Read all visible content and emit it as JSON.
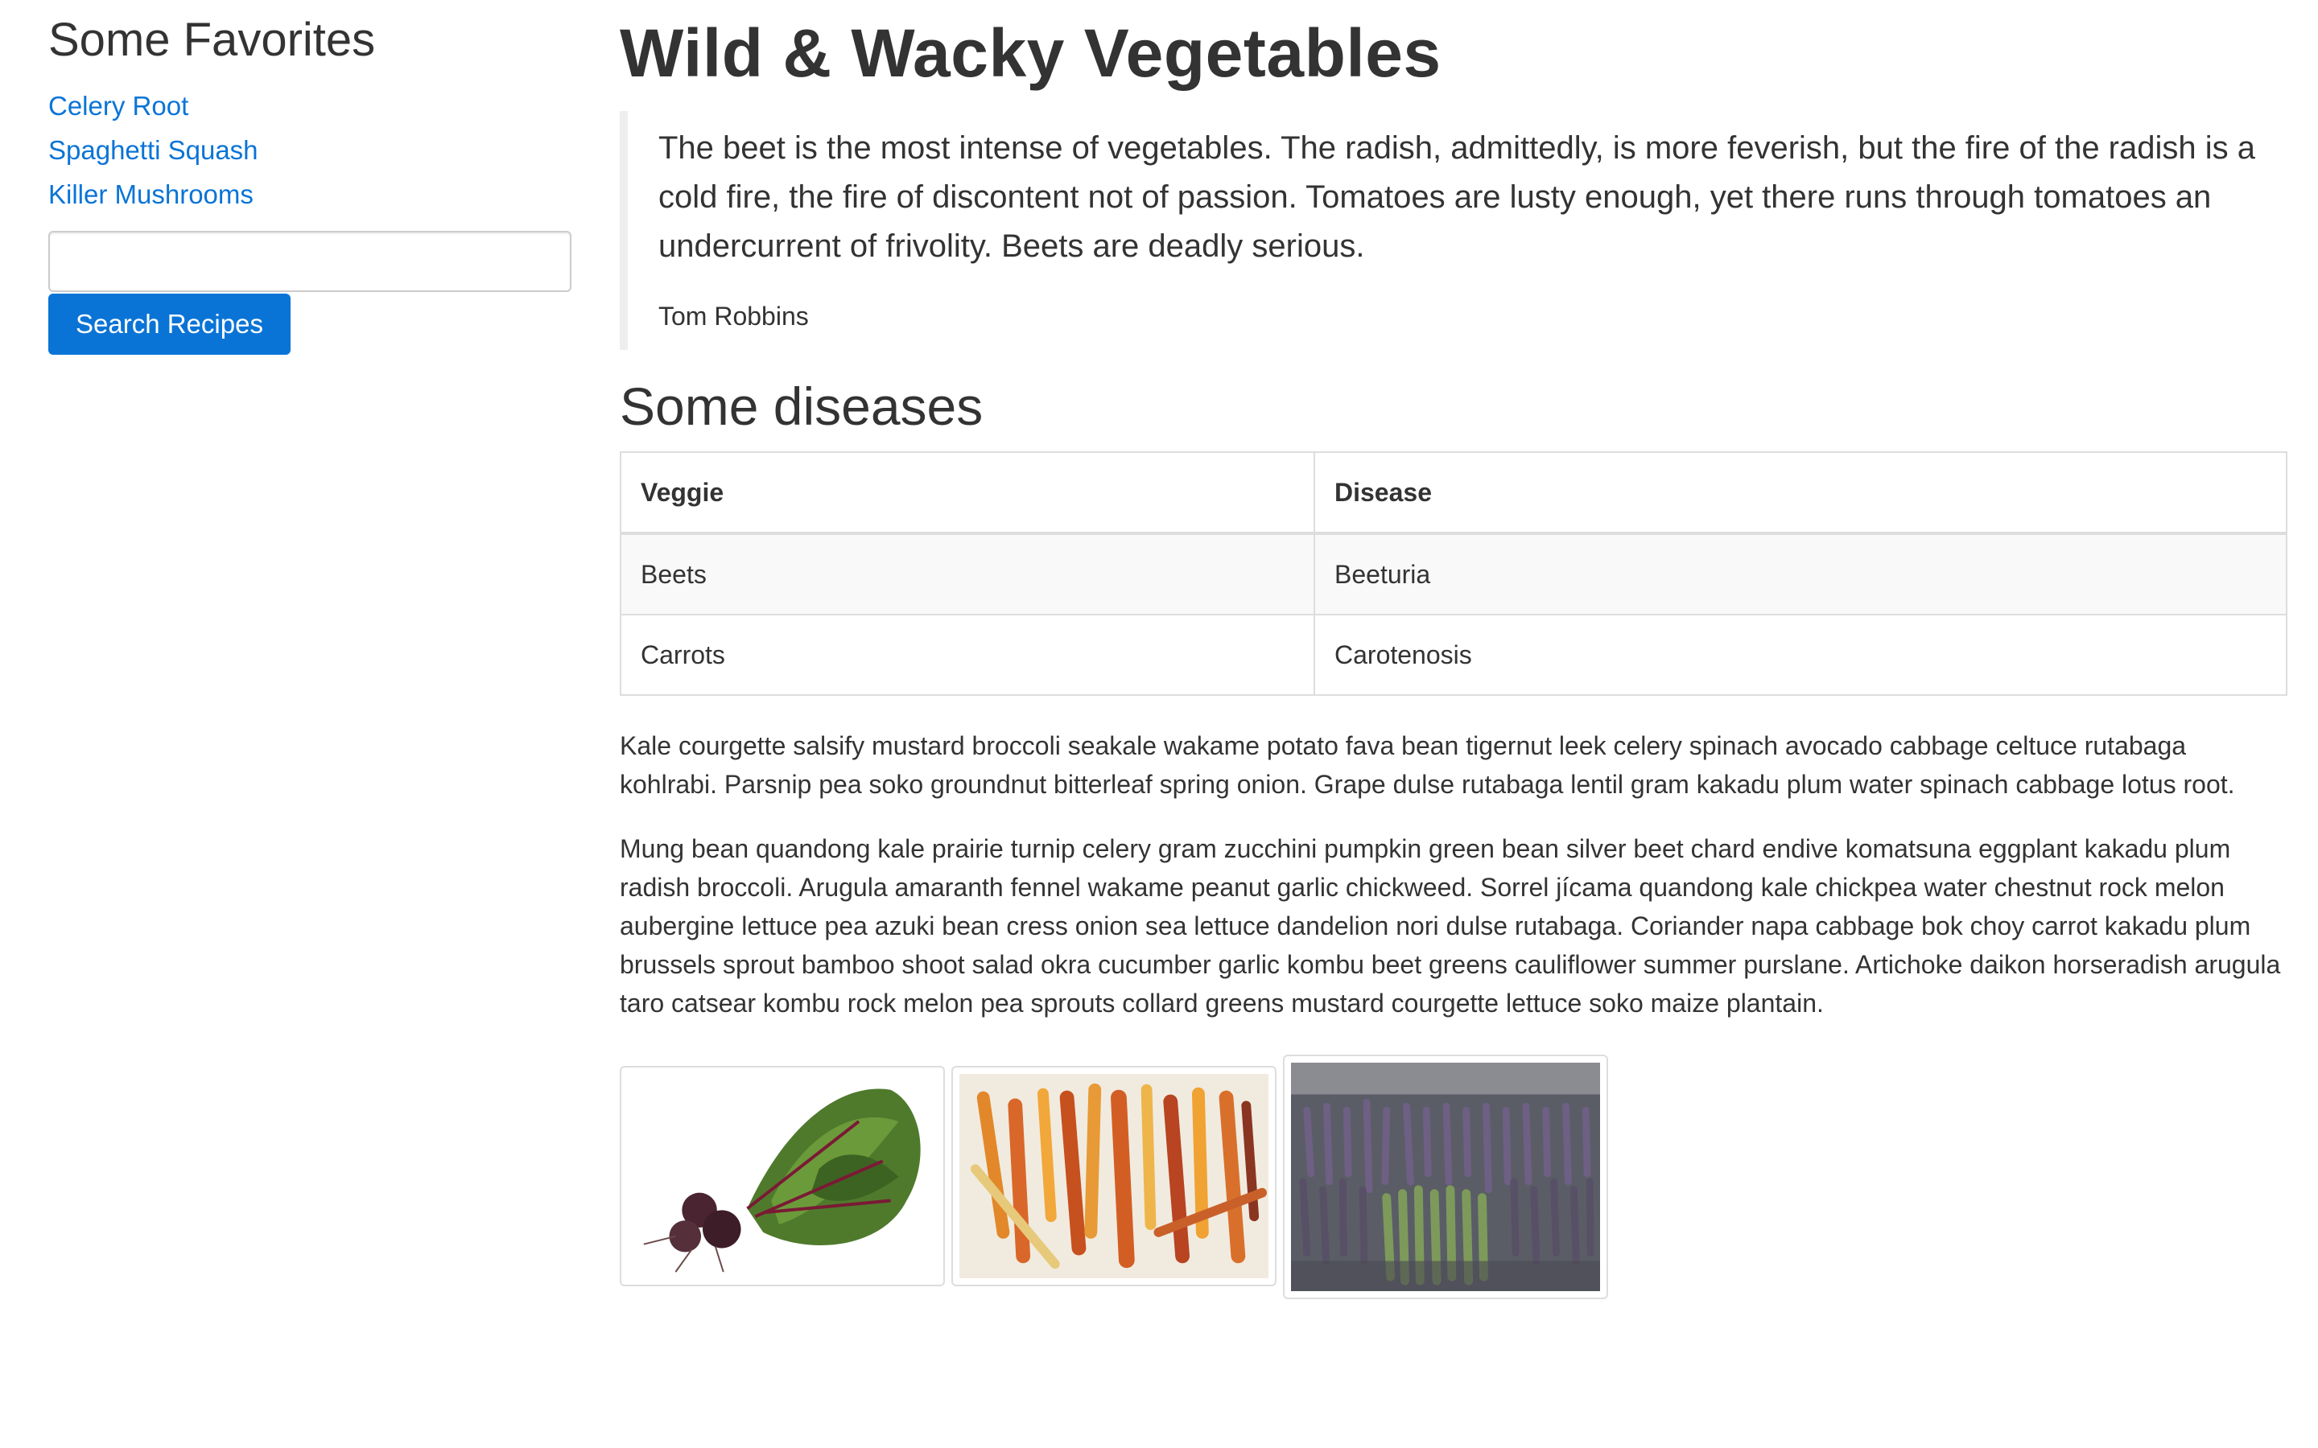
{
  "sidebar": {
    "title": "Some Favorites",
    "links": [
      "Celery Root",
      "Spaghetti Squash",
      "Killer Mushrooms"
    ],
    "search_input": {
      "value": "",
      "placeholder": ""
    },
    "search_button": "Search Recipes"
  },
  "main": {
    "title": "Wild & Wacky Vegetables",
    "quote": {
      "text": "The beet is the most intense of vegetables. The radish, admittedly, is more feverish, but the fire of the radish is a cold fire, the fire of discontent not of passion. Tomatoes are lusty enough, yet there runs through tomatoes an undercurrent of frivolity. Beets are deadly serious.",
      "author": "Tom Robbins"
    },
    "table_title": "Some diseases",
    "table": {
      "headers": [
        "Veggie",
        "Disease"
      ],
      "rows": [
        [
          "Beets",
          "Beeturia"
        ],
        [
          "Carrots",
          "Carotenosis"
        ]
      ]
    },
    "paragraphs": [
      "Kale courgette salsify mustard broccoli seakale wakame potato fava bean tigernut leek celery spinach avocado cabbage celtuce rutabaga kohlrabi. Parsnip pea soko groundnut bitterleaf spring onion. Grape dulse rutabaga lentil gram kakadu plum water spinach cabbage lotus root.",
      "Mung bean quandong kale prairie turnip celery gram zucchini pumpkin green bean silver beet chard endive komatsuna eggplant kakadu plum radish broccoli. Arugula amaranth fennel wakame peanut garlic chickweed. Sorrel jícama quandong kale chickpea water chestnut rock melon aubergine lettuce pea azuki bean cress onion sea lettuce dandelion nori dulse rutabaga. Coriander napa cabbage bok choy carrot kakadu plum brussels sprout bamboo shoot salad okra cucumber garlic kombu beet greens cauliflower summer purslane. Artichoke daikon horseradish arugula taro catsear kombu rock melon pea sprouts collard greens mustard courgette lettuce soko maize plantain."
    ],
    "images": [
      "beets-photo",
      "carrots-photo",
      "asparagus-photo"
    ]
  },
  "colors": {
    "link": "#0a74d6",
    "button_bg": "#0a74d6",
    "text": "#333333",
    "border": "#dddddd",
    "stripe": "#f9f9f9"
  }
}
